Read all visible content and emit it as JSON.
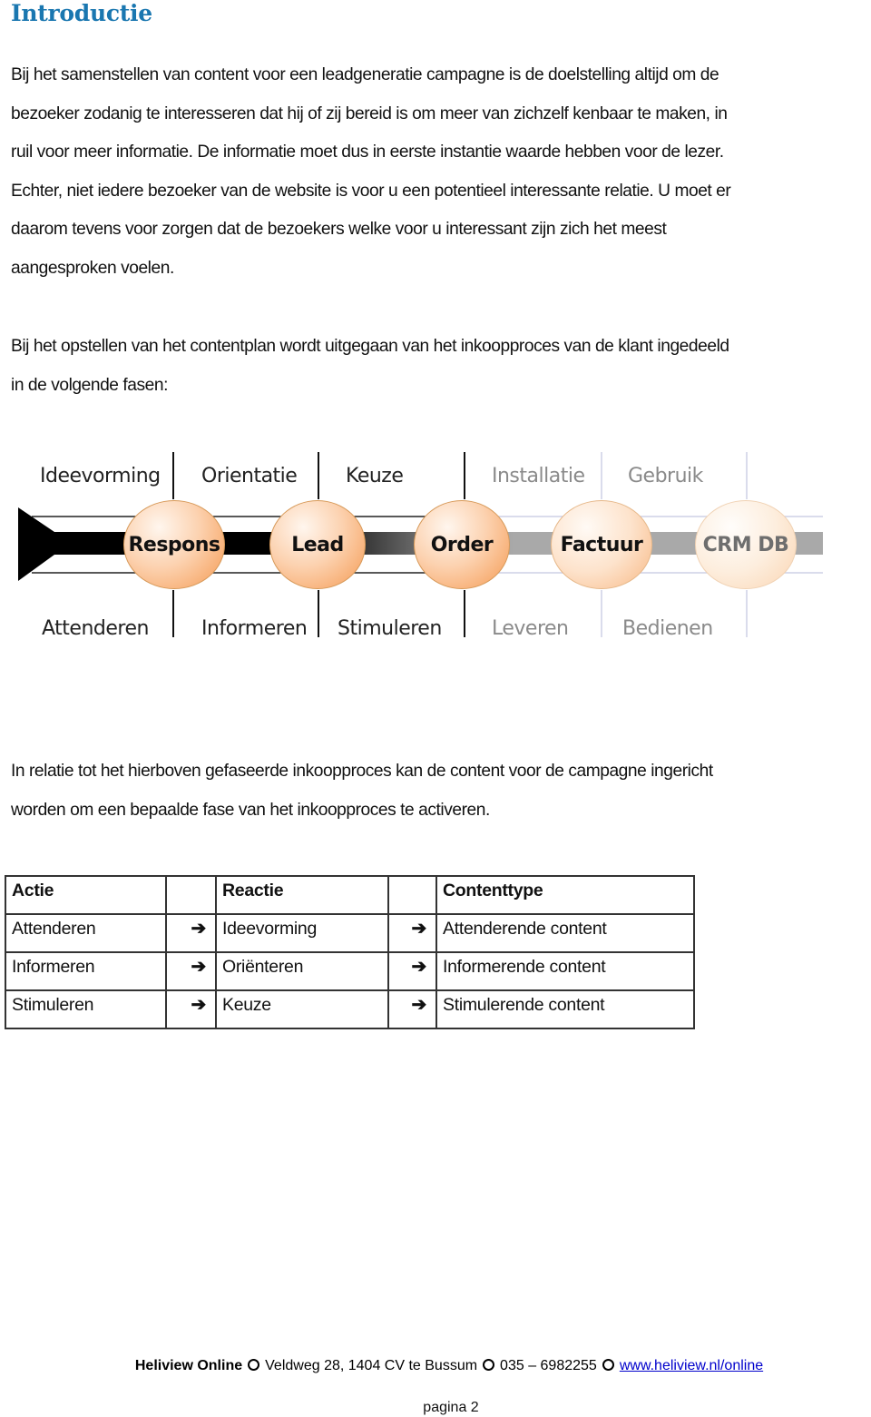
{
  "heading": "Introductie",
  "paragraph1": [
    "Bij het samenstellen van content voor een leadgeneratie campagne is de doelstelling altijd om de",
    "bezoeker zodanig te interesseren dat hij of zij bereid is om meer van zichzelf kenbaar te maken, in",
    "ruil voor meer informatie. De informatie moet dus in eerste instantie waarde hebben voor de lezer.",
    "Echter, niet iedere bezoeker van de website is voor u een potentieel interessante relatie. U moet er",
    "daarom tevens voor zorgen dat de bezoekers welke voor u interessant zijn zich het meest",
    "aangesproken voelen."
  ],
  "paragraph2": [
    "Bij het opstellen van het contentplan wordt uitgegaan van het inkoopproces van de klant ingedeeld",
    "in de volgende fasen:"
  ],
  "diagram": {
    "top_labels": [
      "Ideevorming",
      "Orientatie",
      "Keuze",
      "Installatie",
      "Gebruik"
    ],
    "milestones": [
      "Respons",
      "Lead",
      "Order",
      "Factuur",
      "CRM DB"
    ],
    "bottom_labels": [
      "Attenderen",
      "Informeren",
      "Stimuleren",
      "Leveren",
      "Bedienen"
    ],
    "colors": {
      "accent_orange": "#f59a52",
      "bar_dark": "#000000",
      "bar_light": "#a9a9a9",
      "divider_light": "#cdd0e6"
    }
  },
  "paragraph3": [
    "In relatie tot het hierboven gefaseerde inkoopproces kan de content voor de campagne  ingericht",
    "worden om een bepaalde fase van het inkoopproces te activeren."
  ],
  "table": {
    "headers": [
      "Actie",
      "Reactie",
      "Contenttype"
    ],
    "arrow_icon": "➔",
    "rows": [
      [
        "Attenderen",
        "Ideevorming",
        "Attenderende content"
      ],
      [
        "Informeren",
        "Oriënteren",
        "Informerende content"
      ],
      [
        "Stimuleren",
        "Keuze",
        "Stimulerende content"
      ]
    ]
  },
  "footer": {
    "company": "Heliview Online",
    "address": "Veldweg 28, 1404 CV te Bussum",
    "phone": "035 – 6982255",
    "link": "www.heliview.nl/online",
    "page": "pagina 2"
  }
}
